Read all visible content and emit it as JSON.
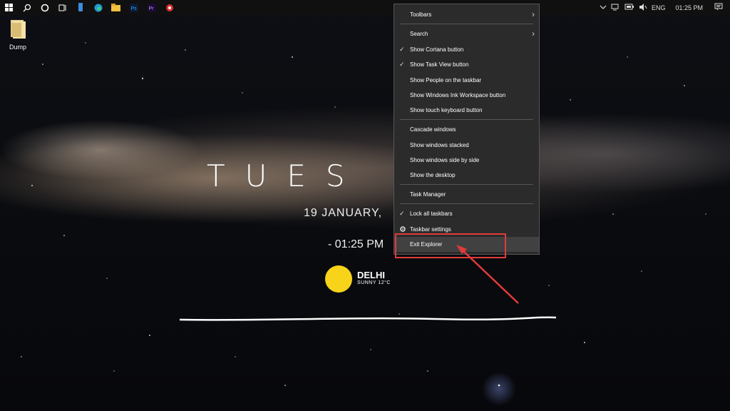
{
  "taskbar": {
    "icons": [
      "windows-start-icon",
      "search-icon",
      "cortana-icon",
      "task-view-icon",
      "phone-app-icon",
      "edge-icon",
      "file-explorer-icon",
      "photoshop-icon",
      "premiere-icon",
      "record-icon"
    ],
    "photoshop_label": "Ps",
    "premiere_label": "Pr",
    "tray": {
      "language": "ENG",
      "clock": "01:25 PM"
    }
  },
  "desktop": {
    "icon_label": "Dump"
  },
  "widget": {
    "day": "TUES",
    "date": "19  JANUARY,",
    "time": "- 01:25 PM",
    "city": "DELHI",
    "weather": "SUNNY 12°C",
    "sun_color": "#f7d31a"
  },
  "context_menu": {
    "items": [
      {
        "label": "Toolbars",
        "submenu": true
      },
      {
        "label": "Search",
        "submenu": true
      },
      {
        "label": "Show Cortana button",
        "checked": true
      },
      {
        "label": "Show Task View button",
        "checked": true
      },
      {
        "label": "Show People on the taskbar"
      },
      {
        "label": "Show Windows Ink Workspace button"
      },
      {
        "label": "Show touch keyboard button"
      },
      {
        "label": "Cascade windows"
      },
      {
        "label": "Show windows stacked"
      },
      {
        "label": "Show windows side by side"
      },
      {
        "label": "Show the desktop"
      },
      {
        "label": "Task Manager"
      },
      {
        "label": "Lock all taskbars",
        "checked": true
      },
      {
        "label": "Taskbar settings",
        "icon": "gear-icon"
      },
      {
        "label": "Exit Explorer",
        "highlighted": true
      }
    ]
  },
  "annotation": {
    "color": "#e23a3a"
  }
}
